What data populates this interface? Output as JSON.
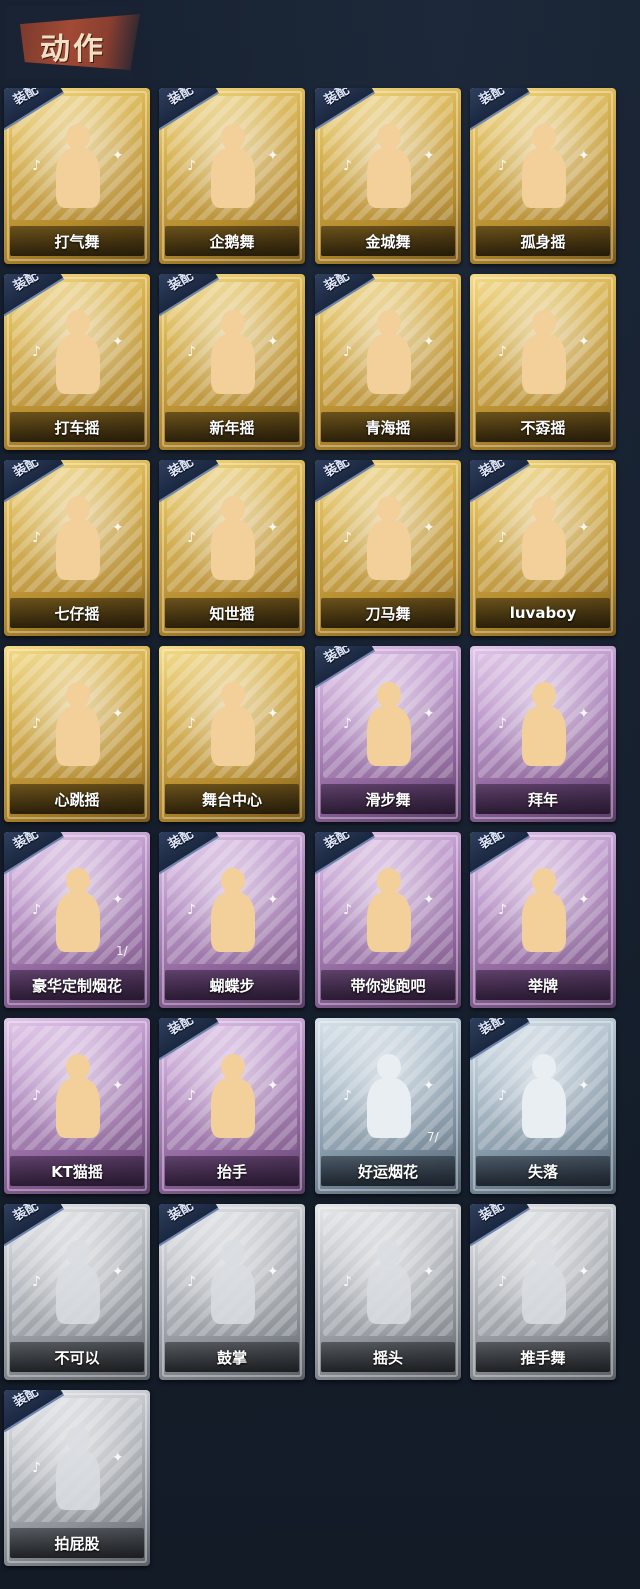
{
  "header": {
    "title": "动作"
  },
  "equip_badge_label": "装配",
  "cards": [
    {
      "name": "打气舞",
      "rarity": "gold",
      "equipped": true
    },
    {
      "name": "企鹅舞",
      "rarity": "gold",
      "equipped": true
    },
    {
      "name": "金城舞",
      "rarity": "gold",
      "equipped": true
    },
    {
      "name": "孤身摇",
      "rarity": "gold",
      "equipped": true
    },
    {
      "name": "打车摇",
      "rarity": "gold",
      "equipped": true
    },
    {
      "name": "新年摇",
      "rarity": "gold",
      "equipped": true
    },
    {
      "name": "青海摇",
      "rarity": "gold",
      "equipped": true
    },
    {
      "name": "不孬摇",
      "rarity": "gold",
      "equipped": false
    },
    {
      "name": "七仔摇",
      "rarity": "gold",
      "equipped": true
    },
    {
      "name": "知世摇",
      "rarity": "gold",
      "equipped": true
    },
    {
      "name": "刀马舞",
      "rarity": "gold",
      "equipped": true
    },
    {
      "name": "luvaboy",
      "rarity": "gold",
      "equipped": true
    },
    {
      "name": "心跳摇",
      "rarity": "gold",
      "equipped": false
    },
    {
      "name": "舞台中心",
      "rarity": "gold",
      "equipped": false
    },
    {
      "name": "滑步舞",
      "rarity": "purple",
      "equipped": true
    },
    {
      "name": "拜年",
      "rarity": "purple",
      "equipped": false
    },
    {
      "name": "豪华定制烟花",
      "rarity": "purple",
      "equipped": true,
      "count": "1/"
    },
    {
      "name": "蝴蝶步",
      "rarity": "purple",
      "equipped": true
    },
    {
      "name": "带你逃跑吧",
      "rarity": "purple",
      "equipped": true
    },
    {
      "name": "举牌",
      "rarity": "purple",
      "equipped": true
    },
    {
      "name": "KT猫摇",
      "rarity": "purple",
      "equipped": false
    },
    {
      "name": "抬手",
      "rarity": "purple",
      "equipped": true
    },
    {
      "name": "好运烟花",
      "rarity": "blue",
      "equipped": false,
      "count": "7/"
    },
    {
      "name": "失落",
      "rarity": "blue",
      "equipped": true
    },
    {
      "name": "不可以",
      "rarity": "gray",
      "equipped": true
    },
    {
      "name": "鼓掌",
      "rarity": "gray",
      "equipped": true
    },
    {
      "name": "摇头",
      "rarity": "gray",
      "equipped": false
    },
    {
      "name": "推手舞",
      "rarity": "gray",
      "equipped": true
    },
    {
      "name": "拍屁股",
      "rarity": "gray",
      "equipped": true
    }
  ],
  "colors": {
    "background": "#141c28",
    "gold": "#d7b24f",
    "purple": "#b791c6",
    "blue": "#a9bac8",
    "gray": "#b8bcc2",
    "badge": "#2e3f5e"
  }
}
